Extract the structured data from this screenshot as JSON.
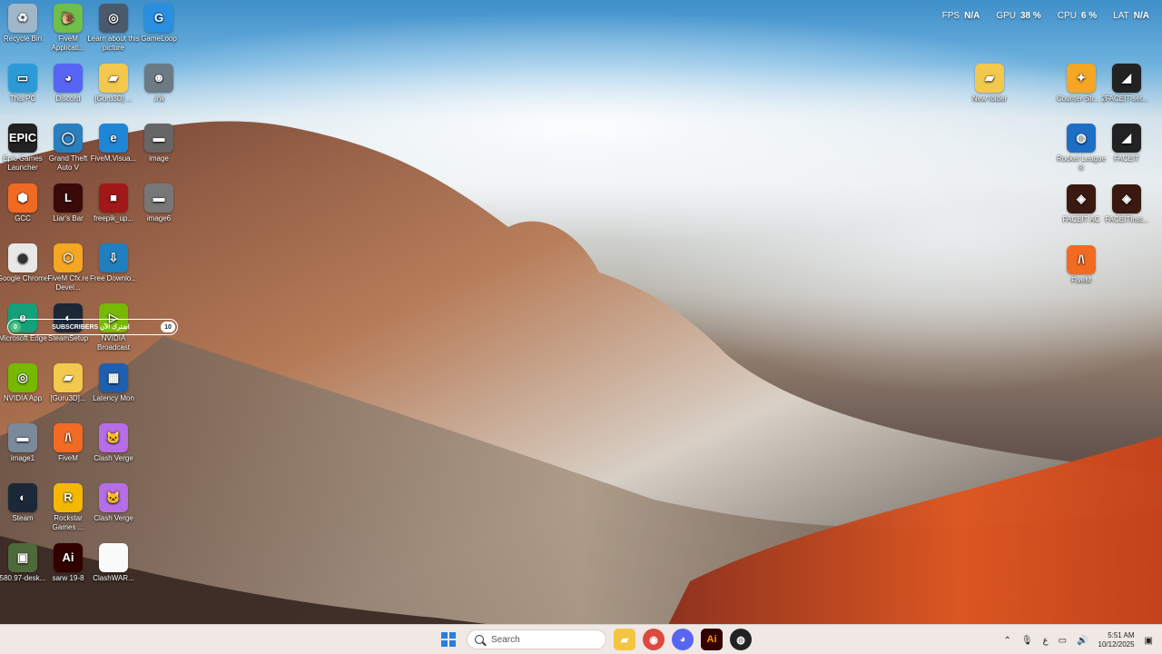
{
  "perf_overlay": {
    "fps_label": "FPS",
    "fps_value": "N/A",
    "gpu_label": "GPU",
    "gpu_value": "38 %",
    "cpu_label": "CPU",
    "cpu_value": "6 %",
    "lat_label": "LAT",
    "lat_value": "N/A"
  },
  "desktop_left": [
    {
      "label": "Recycle Bin",
      "icon": "recycle-bin-icon",
      "color": "#9fb7c9",
      "glyph": "♻"
    },
    {
      "label": "FiveM Applicati...",
      "icon": "fivem-snail-icon",
      "color": "#6fbf4a",
      "glyph": "🐌"
    },
    {
      "label": "Learn about this picture",
      "icon": "camera-icon",
      "color": "#4a5a6a",
      "glyph": "◎"
    },
    {
      "label": "GameLoop",
      "icon": "gameloop-icon",
      "color": "#2a8fe0",
      "glyph": "G"
    },
    {
      "label": "This PC",
      "icon": "monitor-icon",
      "color": "#2d9ad8",
      "glyph": "▭"
    },
    {
      "label": "Discord",
      "icon": "discord-icon",
      "color": "#5865f2",
      "glyph": "◕"
    },
    {
      "label": "[Guru3D] ...",
      "icon": "folder-icon",
      "color": "#f2c94c",
      "glyph": "▰"
    },
    {
      "label": ".lnk",
      "icon": "game-character-icon",
      "color": "#6c7a86",
      "glyph": "☻"
    },
    {
      "label": "Epic Games Launcher",
      "icon": "epic-games-icon",
      "color": "#222",
      "glyph": "EPIC"
    },
    {
      "label": "Grand Theft Auto V",
      "icon": "globe-icon",
      "color": "#2a7fbf",
      "glyph": "◯"
    },
    {
      "label": "FiveM.Visua...",
      "icon": "edge-icon",
      "color": "#1f86d6",
      "glyph": "e"
    },
    {
      "label": "image",
      "icon": "image-icon",
      "color": "#666",
      "glyph": "▬"
    },
    {
      "label": "GCC",
      "icon": "gcc-icon",
      "color": "#f06a24",
      "glyph": "⬢"
    },
    {
      "label": "Liar's Bar",
      "icon": "liars-bar-icon",
      "color": "#3a0a0a",
      "glyph": "L"
    },
    {
      "label": "freepik_up...",
      "icon": "file-red-icon",
      "color": "#a01818",
      "glyph": "■"
    },
    {
      "label": "image6",
      "icon": "image-icon",
      "color": "#777",
      "glyph": "▬"
    },
    {
      "label": "Google Chrome",
      "icon": "chrome-icon",
      "color": "#e8e8e8",
      "glyph": "◉"
    },
    {
      "label": "FiveM Cfx.re Devel...",
      "icon": "cube-icon",
      "color": "#f5a623",
      "glyph": "⬡"
    },
    {
      "label": "Free Downlo...",
      "icon": "download-icon",
      "color": "#1f7fbf",
      "glyph": "⇩"
    },
    {
      "label": "Microsoft Edge",
      "icon": "edge-icon",
      "color": "#14a17a",
      "glyph": "e"
    },
    {
      "label": "SteamSetup",
      "icon": "steam-setup-icon",
      "color": "#1b2838",
      "glyph": "◐"
    },
    {
      "label": "NVIDIA Broadcast",
      "icon": "nvidia-broadcast-icon",
      "color": "#76b900",
      "glyph": "▷"
    },
    {
      "label": "NVIDIA App",
      "icon": "nvidia-icon",
      "color": "#76b900",
      "glyph": "◎"
    },
    {
      "label": "[Guru3D]...",
      "icon": "folder-icon",
      "color": "#f2c94c",
      "glyph": "▰"
    },
    {
      "label": "Latency Mon",
      "icon": "latency-icon",
      "color": "#1f5fb0",
      "glyph": "▦"
    },
    {
      "label": "image1",
      "icon": "image-thumb-icon",
      "color": "#7a8a9a",
      "glyph": "▬"
    },
    {
      "label": "FiveM",
      "icon": "fivem-icon",
      "color": "#f26b22",
      "glyph": "/\\"
    },
    {
      "label": "Clash Verge",
      "icon": "clash-verge-icon",
      "color": "#b56ee6",
      "glyph": "🐱"
    },
    {
      "label": "Steam",
      "icon": "steam-icon",
      "color": "#1b2838",
      "glyph": "◐"
    },
    {
      "label": "Rockstar Games ...",
      "icon": "rockstar-icon",
      "color": "#f5b800",
      "glyph": "R"
    },
    {
      "label": "Clash Verge",
      "icon": "clash-verge-icon",
      "color": "#b56ee6",
      "glyph": "🐱"
    },
    {
      "label": "580.97-desk...",
      "icon": "nvidia-installer-icon",
      "color": "#4f6a3a",
      "glyph": "▣"
    },
    {
      "label": "sarw 19-8",
      "icon": "illustrator-icon",
      "color": "#330000",
      "glyph": "Ai"
    },
    {
      "label": "ClashWAR...",
      "icon": "document-icon",
      "color": "#fafafa",
      "glyph": " "
    }
  ],
  "desktop_right": [
    {
      "label": "New folder",
      "icon": "folder-icon",
      "color": "#f2c94c",
      "glyph": "▰"
    },
    {
      "label": "Counter-Str... 2",
      "icon": "counter-strike-icon",
      "color": "#f5a623",
      "glyph": "✦"
    },
    {
      "label": "FACEIT-set...",
      "icon": "faceit-icon",
      "color": "#222",
      "glyph": "◢"
    },
    {
      "label": "Rocket League ®",
      "icon": "rocket-league-icon",
      "color": "#1e6fc4",
      "glyph": "◍"
    },
    {
      "label": "FACEIT",
      "icon": "faceit-icon",
      "color": "#222",
      "glyph": "◢"
    },
    {
      "label": "FACEIT AC",
      "icon": "faceit-ac-icon",
      "color": "#3a1a10",
      "glyph": "◈"
    },
    {
      "label": "FACEITInst...",
      "icon": "faceit-installer-icon",
      "color": "#3a1a10",
      "glyph": "◈"
    },
    {
      "label": "FiveM",
      "icon": "fivem-icon",
      "color": "#f26b22",
      "glyph": "/\\"
    }
  ],
  "subscribers_widget": {
    "left_value": "0",
    "text": "SUBSCRIBERS  اشترك الآن",
    "right_value": "10"
  },
  "taskbar": {
    "search_placeholder": "Search",
    "clock_time": "5:51 AM",
    "clock_date": "10/12/2025",
    "tray_lang": "ع"
  }
}
